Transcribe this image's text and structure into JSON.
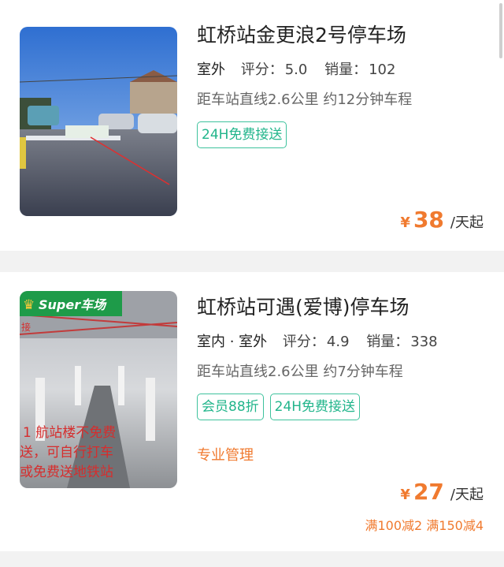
{
  "lots": [
    {
      "name": "虹桥站金更浪2号停车场",
      "type": "室外",
      "rating_label": "评分：",
      "rating": "5.0",
      "sales_label": "销量：",
      "sales": "102",
      "distance": "距车站直线2.6公里 约12分钟车程",
      "tags": [
        "24H免费接送"
      ],
      "currency": "¥",
      "price": "38",
      "unit": "/天起"
    },
    {
      "name": "虹桥站可遇(爱博)停车场",
      "type": "室内 · 室外",
      "rating_label": "评分：",
      "rating": "4.9",
      "sales_label": "销量：",
      "sales": "338",
      "distance": "距车站直线2.6公里 约7分钟车程",
      "tags": [
        "会员88折",
        "24H免费接送"
      ],
      "management": "专业管理",
      "currency": "¥",
      "price": "27",
      "unit": "/天起",
      "promo": "满100减2 满150减4",
      "badge": "Super车场",
      "overlay_text": [
        "1 航站楼不免费",
        "送，可自行打车",
        "或免费送地铁站"
      ],
      "overlay_prefix": "接"
    }
  ],
  "colors": {
    "accent_green": "#21b58b",
    "price_orange": "#f07a2f",
    "badge_green": "#1e9b49"
  }
}
